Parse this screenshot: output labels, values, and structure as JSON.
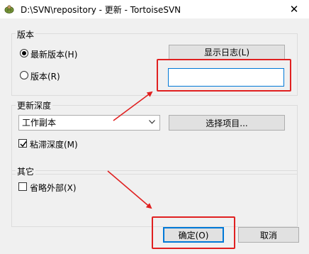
{
  "window": {
    "title": "D:\\SVN\\repository - 更新 - TortoiseSVN",
    "close_glyph": "✕",
    "app_icon": "tortoisesvn-icon"
  },
  "revision_group": {
    "label": "版本",
    "head_revision_label": "最新版本(H)",
    "revision_label": "版本(R)",
    "selected": "head",
    "show_log_label": "显示日志(L)",
    "revision_value": ""
  },
  "depth_group": {
    "label": "更新深度",
    "depth_selected": "工作副本",
    "choose_items_label": "选择项目...",
    "sticky_depth_label": "粘滞深度(M)",
    "sticky_checked": true
  },
  "other_group": {
    "label": "其它",
    "omit_externals_label": "省略外部(X)",
    "omit_checked": false
  },
  "footer": {
    "ok_label": "确定(O)",
    "cancel_label": "取消"
  },
  "annotations": {
    "color": "#e02020"
  }
}
